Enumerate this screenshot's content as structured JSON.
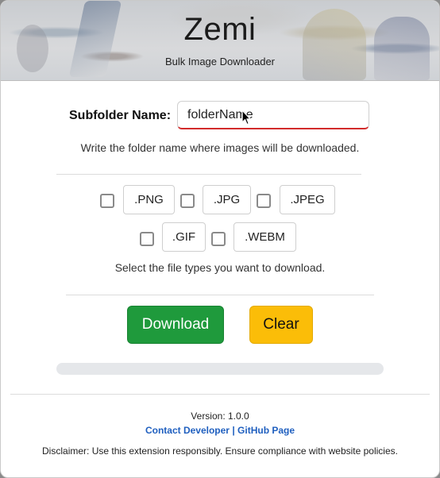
{
  "app": {
    "title": "Zemi",
    "subtitle": "Bulk Image Downloader"
  },
  "subfolder": {
    "label": "Subfolder Name:",
    "value": "folderName",
    "hint": "Write the folder name where images will be downloaded."
  },
  "file_types": {
    "items": [
      {
        "label": ".PNG",
        "checked": false
      },
      {
        "label": ".JPG",
        "checked": false
      },
      {
        "label": ".JPEG",
        "checked": false
      },
      {
        "label": ".GIF",
        "checked": false
      },
      {
        "label": ".WEBM",
        "checked": false
      }
    ],
    "hint": "Select the file types you want to download."
  },
  "actions": {
    "download_label": "Download",
    "clear_label": "Clear",
    "download_color": "#1f9a3c",
    "clear_color": "#fbbd08"
  },
  "progress": {
    "fraction": 0
  },
  "footer": {
    "version": "Version: 1.0.0",
    "contact_label": "Contact Developer",
    "separator": "|",
    "github_label": "GitHub Page",
    "disclaimer": "Disclaimer: Use this extension responsibly. Ensure compliance with website policies."
  },
  "colors": {
    "link": "#1f5fbf",
    "input_underline": "#d22b2b"
  }
}
